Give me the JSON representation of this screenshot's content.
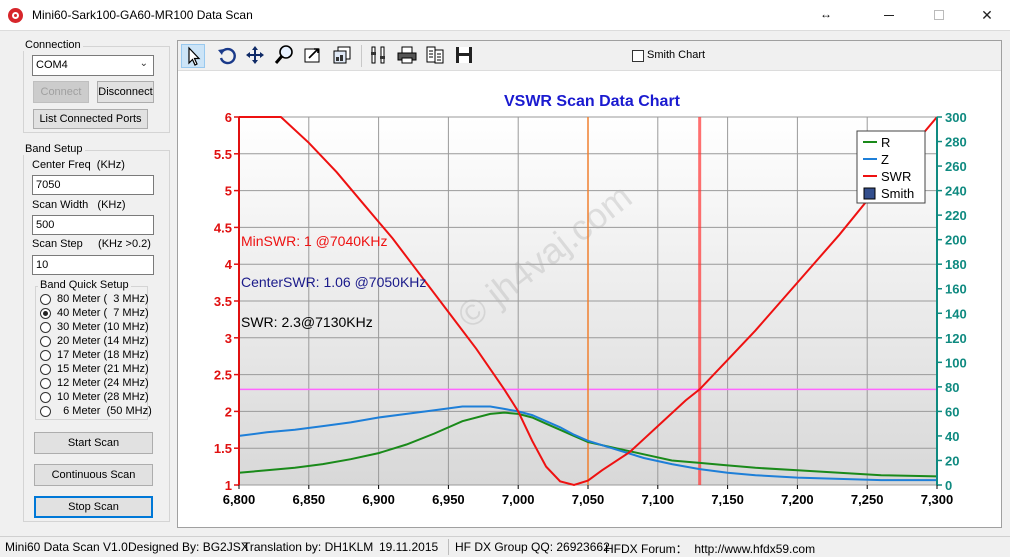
{
  "window": {
    "title": "Mini60-Sark100-GA60-MR100 Data Scan"
  },
  "connection": {
    "group_label": "Connection",
    "port_selected": "COM4",
    "connect_label": "Connect",
    "disconnect_label": "Disconnect",
    "list_ports_label": "List Connected Ports"
  },
  "band_setup": {
    "group_label": "Band Setup",
    "center_freq_label": "Center Freq  (KHz)",
    "center_freq_value": "7050",
    "scan_width_label": "Scan Width   (KHz)",
    "scan_width_value": "500",
    "scan_step_label": "Scan Step     (KHz >0.2)",
    "scan_step_value": "10",
    "quick_setup_label": "Band Quick Setup",
    "bands": [
      {
        "label": "80 Meter (  3 MHz)",
        "checked": false
      },
      {
        "label": "40 Meter (  7 MHz)",
        "checked": true
      },
      {
        "label": "30 Meter (10 MHz)",
        "checked": false
      },
      {
        "label": "20 Meter (14 MHz)",
        "checked": false
      },
      {
        "label": "17 Meter (18 MHz)",
        "checked": false
      },
      {
        "label": "15 Meter (21 MHz)",
        "checked": false
      },
      {
        "label": "12 Meter (24 MHz)",
        "checked": false
      },
      {
        "label": "10 Meter (28 MHz)",
        "checked": false
      },
      {
        "label": "  6 Meter  (50 MHz)",
        "checked": false
      }
    ]
  },
  "actions": {
    "start_scan_label": "Start Scan",
    "continuous_scan_label": "Continuous Scan",
    "stop_scan_label": "Stop Scan"
  },
  "toolbar": {
    "icons": [
      "pointer-icon",
      "undo-icon",
      "pan-icon",
      "zoom-icon",
      "zoom-fit-icon",
      "copy-icon",
      "properties-icon",
      "print-icon",
      "export-icon",
      "save-icon"
    ],
    "smith_chart_label": "Smith Chart",
    "smith_chart_checked": false
  },
  "status": {
    "version": "Mini60 Data Scan V1.0",
    "designed_by": "Designed By: BG2JSX",
    "translation": "Translation by: DH1KLM",
    "date": "19.11.2015",
    "group": "HF DX Group QQ: 26923662",
    "forum": "HFDX Forum：  http://www.hfdx59.com"
  },
  "chart_data": {
    "type": "line",
    "title": "VSWR Scan Data Chart",
    "watermark": "© jh4vaj.com",
    "x_ticks": [
      "6,800",
      "6,850",
      "6,900",
      "6,950",
      "7,000",
      "7,050",
      "7,100",
      "7,150",
      "7,200",
      "7,250",
      "7,300"
    ],
    "xlim": [
      6800,
      7300
    ],
    "y_left_ticks": [
      "1",
      "1.5",
      "2",
      "2.5",
      "3",
      "3.5",
      "4",
      "4.5",
      "5",
      "5.5",
      "6"
    ],
    "ylim_left": [
      1,
      6
    ],
    "y_right_ticks": [
      "0",
      "20",
      "40",
      "60",
      "80",
      "100",
      "120",
      "140",
      "160",
      "180",
      "200",
      "220",
      "240",
      "260",
      "280",
      "300"
    ],
    "ylim_right": [
      0,
      300
    ],
    "legend": [
      "R",
      "Z",
      "SWR",
      "Smith"
    ],
    "legend_position": "top-right",
    "grid": true,
    "colors": {
      "R": "#1a8a1a",
      "Z": "#1e7fd8",
      "SWR": "#ee1111",
      "Smith": "#334e8c",
      "swr_marker": "#ff3333",
      "center_marker": "#f08030",
      "ref_line": "#ff66ff",
      "left_axis": "#e01010",
      "right_axis": "#0f8a80",
      "title": "#1a1ad0"
    },
    "annotations": [
      {
        "text": "MinSWR: 1 @7040KHz",
        "color": "#ee1111"
      },
      {
        "text": "CenterSWR: 1.06 @7050KHz",
        "color": "#1a1a8a"
      },
      {
        "text": "SWR: 2.3@7130KHz",
        "color": "#000000"
      }
    ],
    "center_marker_freq": 7050,
    "swr_marker_freq": 7130,
    "reference_swr": 2.3,
    "series": [
      {
        "name": "SWR",
        "axis": "left",
        "x": [
          6800,
          6830,
          6850,
          6870,
          6890,
          6910,
          6930,
          6950,
          6970,
          6990,
          7000,
          7010,
          7020,
          7030,
          7040,
          7050,
          7060,
          7080,
          7100,
          7120,
          7130,
          7150,
          7170,
          7200,
          7230,
          7260,
          7280,
          7300
        ],
        "y": [
          6.0,
          6.0,
          5.65,
          5.25,
          4.8,
          4.35,
          3.85,
          3.35,
          2.85,
          2.3,
          2.0,
          1.6,
          1.25,
          1.05,
          1.0,
          1.06,
          1.2,
          1.45,
          1.8,
          2.15,
          2.3,
          2.7,
          3.1,
          3.75,
          4.4,
          5.1,
          5.55,
          6.0
        ]
      },
      {
        "name": "R",
        "axis": "right",
        "x": [
          6800,
          6820,
          6840,
          6860,
          6880,
          6900,
          6920,
          6940,
          6960,
          6980,
          6990,
          7000,
          7010,
          7020,
          7030,
          7040,
          7050,
          7070,
          7090,
          7110,
          7130,
          7150,
          7170,
          7200,
          7230,
          7260,
          7300
        ],
        "y": [
          10,
          12,
          14,
          17,
          21,
          26,
          33,
          42,
          52,
          58,
          59,
          58,
          55,
          50,
          45,
          40,
          35,
          30,
          25,
          20,
          18,
          16,
          14,
          12,
          10,
          8,
          7
        ]
      },
      {
        "name": "Z",
        "axis": "right",
        "x": [
          6800,
          6820,
          6840,
          6860,
          6880,
          6900,
          6920,
          6940,
          6960,
          6980,
          6990,
          7000,
          7010,
          7020,
          7030,
          7040,
          7050,
          7070,
          7090,
          7110,
          7130,
          7150,
          7170,
          7200,
          7230,
          7260,
          7300
        ],
        "y": [
          40,
          43,
          45,
          48,
          51,
          55,
          58,
          61,
          64,
          64,
          62,
          60,
          57,
          52,
          47,
          41,
          36,
          29,
          22,
          17,
          13,
          10,
          8,
          6,
          5,
          4,
          4
        ]
      }
    ]
  }
}
